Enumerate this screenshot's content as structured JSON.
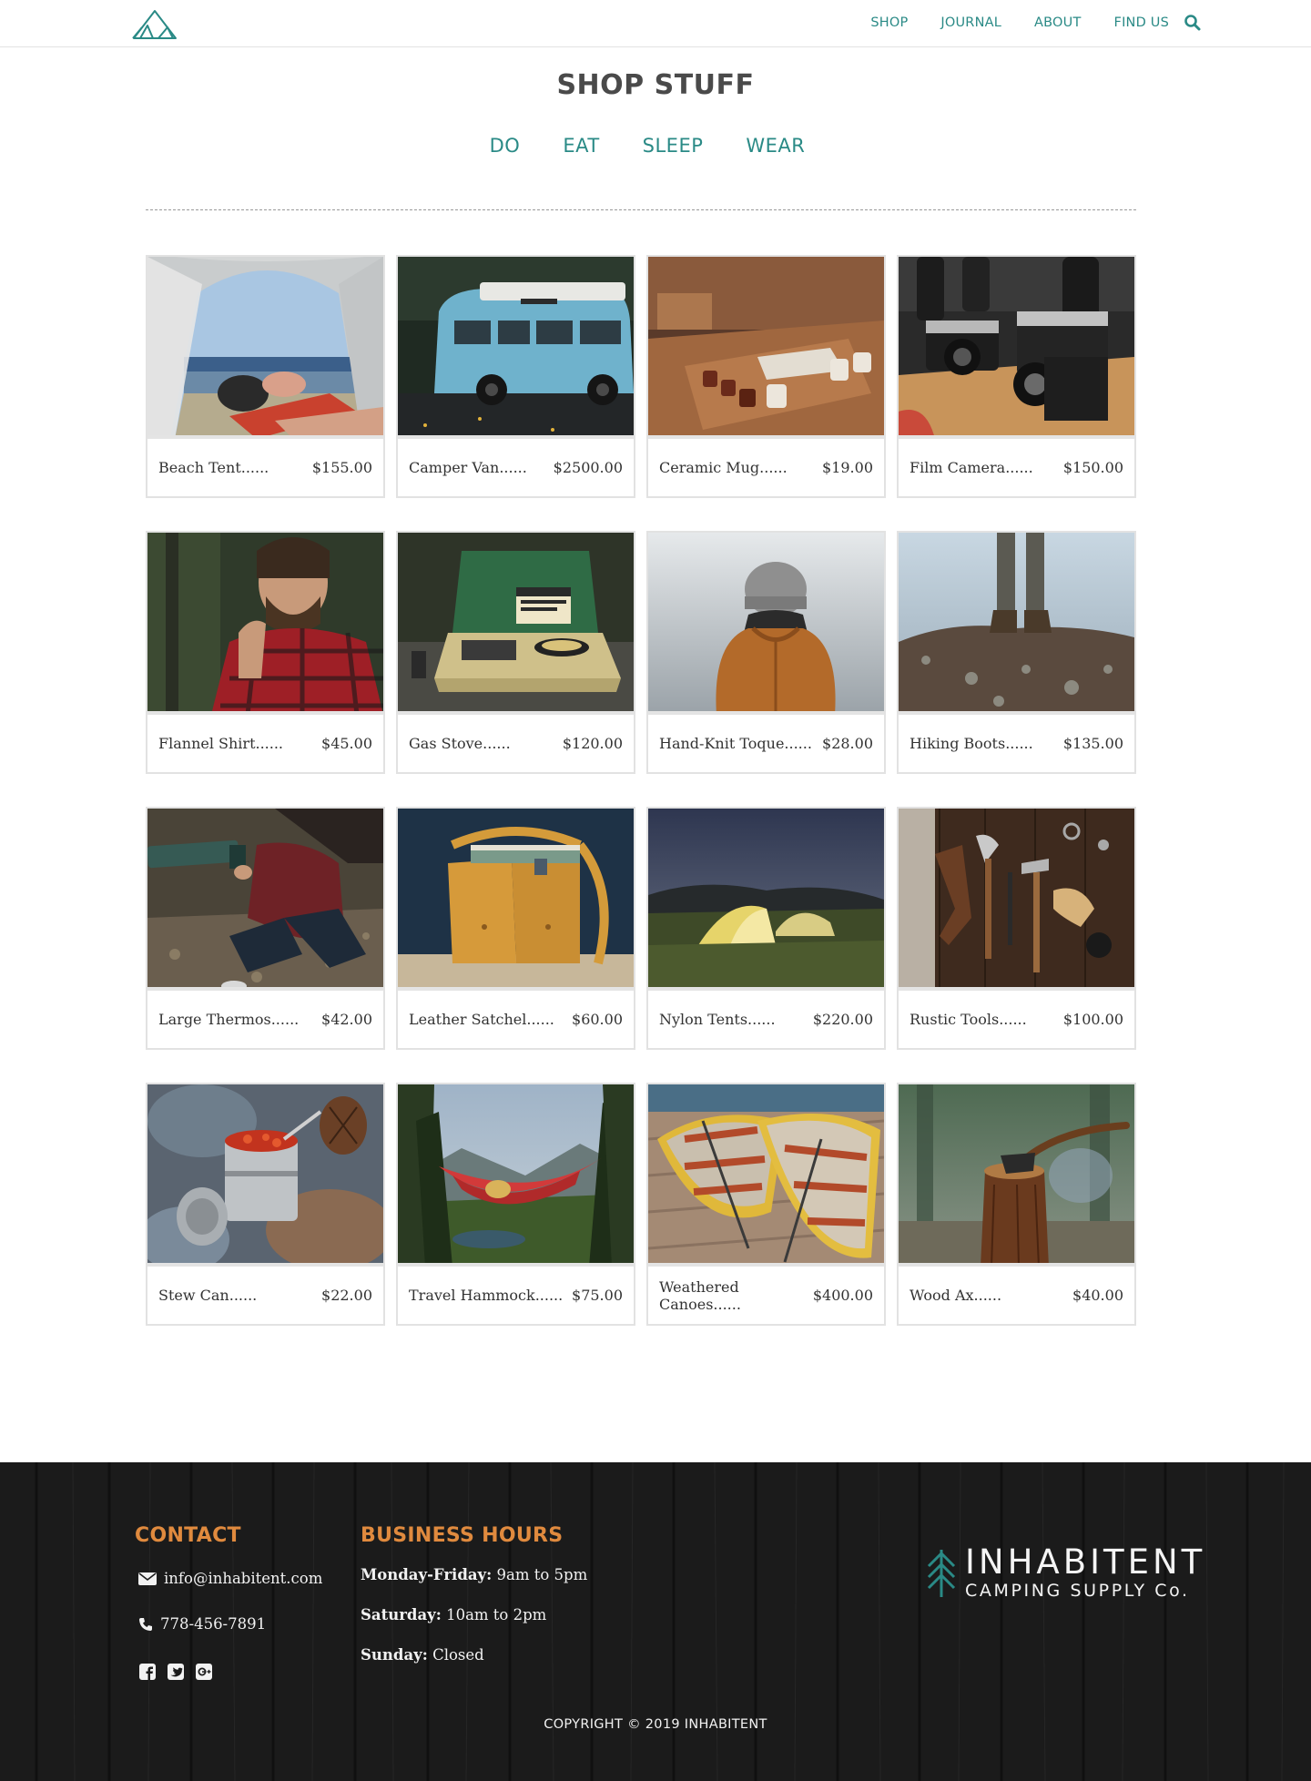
{
  "header": {
    "nav": [
      "SHOP",
      "JOURNAL",
      "ABOUT",
      "FIND US"
    ]
  },
  "main": {
    "title": "SHOP STUFF",
    "categories": [
      "DO",
      "EAT",
      "SLEEP",
      "WEAR"
    ]
  },
  "products": [
    {
      "name": "Beach Tent",
      "price": "$155.00"
    },
    {
      "name": "Camper Van",
      "price": "$2500.00"
    },
    {
      "name": "Ceramic Mug",
      "price": "$19.00"
    },
    {
      "name": "Film Camera",
      "price": "$150.00"
    },
    {
      "name": "Flannel Shirt",
      "price": "$45.00"
    },
    {
      "name": "Gas Stove",
      "price": "$120.00"
    },
    {
      "name": "Hand-Knit Toque",
      "price": "$28.00"
    },
    {
      "name": "Hiking Boots",
      "price": "$135.00"
    },
    {
      "name": "Large Thermos",
      "price": "$42.00"
    },
    {
      "name": "Leather Satchel",
      "price": "$60.00"
    },
    {
      "name": "Nylon Tents",
      "price": "$220.00"
    },
    {
      "name": "Rustic Tools",
      "price": "$100.00"
    },
    {
      "name": "Stew Can",
      "price": "$22.00"
    },
    {
      "name": "Travel Hammock",
      "price": "$75.00"
    },
    {
      "name": "Weathered Canoes",
      "price": "$400.00"
    },
    {
      "name": "Wood Ax",
      "price": "$40.00"
    }
  ],
  "dots": "......",
  "footer": {
    "contact_heading": "CONTACT",
    "email": "info@inhabitent.com",
    "phone": "778-456-7891",
    "hours_heading": "BUSINESS HOURS",
    "hours": [
      {
        "day": "Monday-Friday:",
        "time": "9am to 5pm"
      },
      {
        "day": "Saturday:",
        "time": "10am to 2pm"
      },
      {
        "day": "Sunday:",
        "time": "Closed"
      }
    ],
    "brand_name": "INHABITENT",
    "brand_sub": "CAMPING SUPPLY Co.",
    "copyright": "COPYRIGHT © 2019 INHABITENT"
  },
  "colors": {
    "accent": "#2a8a86",
    "footer_heading": "#e08a3e",
    "footer_bg": "#1a1a1a"
  },
  "icons": [
    "tent-logo-icon",
    "search-icon",
    "envelope-icon",
    "phone-icon",
    "facebook-icon",
    "twitter-icon",
    "google-plus-icon",
    "tree-logo-icon"
  ]
}
